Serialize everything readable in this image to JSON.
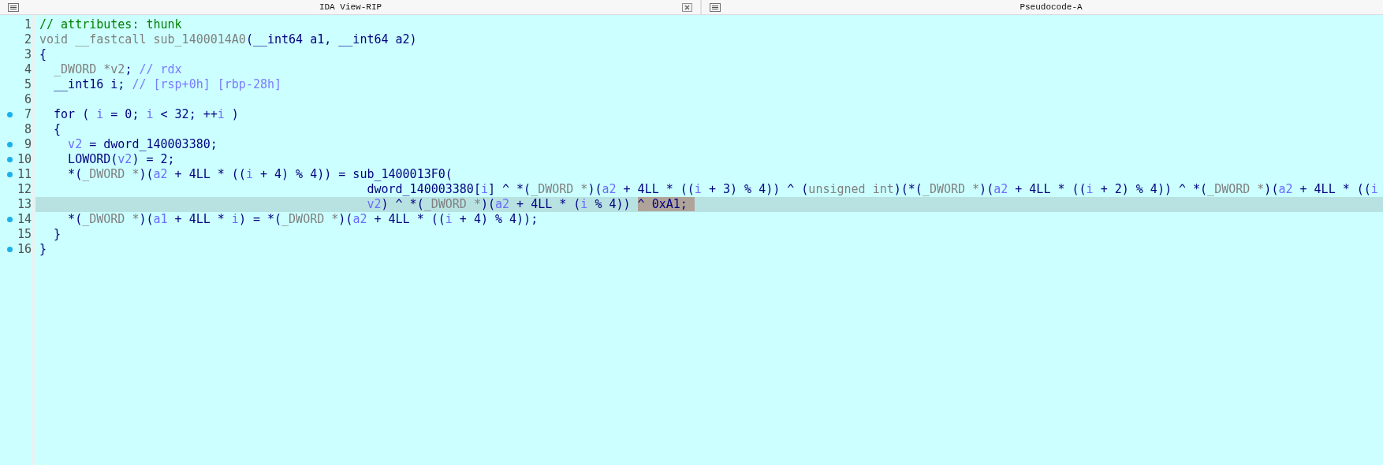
{
  "tabs": [
    {
      "title": "IDA View-RIP",
      "closable": true
    },
    {
      "title": "Pseudocode-A",
      "closable": false
    }
  ],
  "lines": [
    {
      "number": "1",
      "marked": false,
      "selected": false,
      "tokens": [
        {
          "kind": "attr",
          "text": "// attributes: thunk"
        }
      ]
    },
    {
      "number": "2",
      "marked": false,
      "selected": false,
      "tokens": [
        {
          "kind": "type",
          "text": "void __fastcall sub_1400014A0"
        },
        {
          "kind": "code",
          "text": "(__int64 a1, __int64 a2)"
        }
      ]
    },
    {
      "number": "3",
      "marked": false,
      "selected": false,
      "tokens": [
        {
          "kind": "code",
          "text": "{"
        }
      ]
    },
    {
      "number": "4",
      "marked": false,
      "selected": false,
      "tokens": [
        {
          "kind": "type",
          "text": "  _DWORD *v2"
        },
        {
          "kind": "code",
          "text": ";"
        },
        {
          "kind": "comment",
          "text": " // rdx"
        }
      ]
    },
    {
      "number": "5",
      "marked": false,
      "selected": false,
      "tokens": [
        {
          "kind": "code",
          "text": "  __int16 i;"
        },
        {
          "kind": "comment",
          "text": " // [rsp+0h] [rbp-28h]"
        }
      ]
    },
    {
      "number": "6",
      "marked": false,
      "selected": false
    },
    {
      "number": "7",
      "marked": true,
      "selected": false,
      "tokens": [
        {
          "kind": "code",
          "text": "  for ( "
        },
        {
          "kind": "var",
          "text": "i"
        },
        {
          "kind": "code",
          "text": " = 0; "
        },
        {
          "kind": "var",
          "text": "i"
        },
        {
          "kind": "code",
          "text": " < 32; ++"
        },
        {
          "kind": "var",
          "text": "i"
        },
        {
          "kind": "code",
          "text": " )"
        }
      ]
    },
    {
      "number": "8",
      "marked": false,
      "selected": false,
      "tokens": [
        {
          "kind": "code",
          "text": "  {"
        }
      ]
    },
    {
      "number": "9",
      "marked": true,
      "selected": false,
      "tokens": [
        {
          "kind": "var",
          "text": "    v2"
        },
        {
          "kind": "code",
          "text": " = dword_140003380;"
        }
      ]
    },
    {
      "number": "10",
      "marked": true,
      "selected": false,
      "tokens": [
        {
          "kind": "code",
          "text": "    LOWORD("
        },
        {
          "kind": "var",
          "text": "v2"
        },
        {
          "kind": "code",
          "text": ") = 2;"
        }
      ]
    },
    {
      "number": "11",
      "marked": true,
      "selected": false,
      "tokens": [
        {
          "kind": "code",
          "text": "    *("
        },
        {
          "kind": "type",
          "text": "_DWORD *"
        },
        {
          "kind": "code",
          "text": ")("
        },
        {
          "kind": "var",
          "text": "a2"
        },
        {
          "kind": "code",
          "text": " + 4LL * (("
        },
        {
          "kind": "var",
          "text": "i"
        },
        {
          "kind": "code",
          "text": " + 4) % 4)) = sub_1400013F0("
        }
      ]
    },
    {
      "number": "12",
      "marked": false,
      "selected": false,
      "tokens": [
        {
          "kind": "code",
          "text": "                                              dword_140003380["
        },
        {
          "kind": "var",
          "text": "i"
        },
        {
          "kind": "code",
          "text": "] ^ *("
        },
        {
          "kind": "type",
          "text": "_DWORD *"
        },
        {
          "kind": "code",
          "text": ")("
        },
        {
          "kind": "var",
          "text": "a2"
        },
        {
          "kind": "code",
          "text": " + 4LL * (("
        },
        {
          "kind": "var",
          "text": "i"
        },
        {
          "kind": "code",
          "text": " + 3) % 4)) ^ ("
        },
        {
          "kind": "type",
          "text": "unsigned int"
        },
        {
          "kind": "code",
          "text": ")(*("
        },
        {
          "kind": "type",
          "text": "_DWORD *"
        },
        {
          "kind": "code",
          "text": ")("
        },
        {
          "kind": "var",
          "text": "a2"
        },
        {
          "kind": "code",
          "text": " + 4LL * (("
        },
        {
          "kind": "var",
          "text": "i"
        },
        {
          "kind": "code",
          "text": " + 2) % 4)) ^ *("
        },
        {
          "kind": "type",
          "text": "_DWORD *"
        },
        {
          "kind": "code",
          "text": ")("
        },
        {
          "kind": "var",
          "text": "a2"
        },
        {
          "kind": "code",
          "text": " + 4LL * (("
        },
        {
          "kind": "var",
          "text": "i"
        }
      ]
    },
    {
      "number": "13",
      "marked": false,
      "selected": true,
      "tokens": [
        {
          "kind": "var",
          "text": "                                              v2"
        },
        {
          "kind": "code",
          "text": ") ^ *("
        },
        {
          "kind": "type",
          "text": "_DWORD *"
        },
        {
          "kind": "code",
          "text": ")("
        },
        {
          "kind": "var",
          "text": "a2"
        },
        {
          "kind": "code",
          "text": " + 4LL * ("
        },
        {
          "kind": "var",
          "text": "i"
        },
        {
          "kind": "code",
          "text": " % 4)) "
        },
        {
          "kind": "code",
          "text": "^ 0xA1;",
          "highlighted": true
        }
      ]
    },
    {
      "number": "14",
      "marked": true,
      "selected": false,
      "tokens": [
        {
          "kind": "code",
          "text": "    *("
        },
        {
          "kind": "type",
          "text": "_DWORD *"
        },
        {
          "kind": "code",
          "text": ")("
        },
        {
          "kind": "var",
          "text": "a1"
        },
        {
          "kind": "code",
          "text": " + 4LL * "
        },
        {
          "kind": "var",
          "text": "i"
        },
        {
          "kind": "code",
          "text": ") = *("
        },
        {
          "kind": "type",
          "text": "_DWORD *"
        },
        {
          "kind": "code",
          "text": ")("
        },
        {
          "kind": "var",
          "text": "a2"
        },
        {
          "kind": "code",
          "text": " + 4LL * (("
        },
        {
          "kind": "var",
          "text": "i"
        },
        {
          "kind": "code",
          "text": " + 4) % 4));"
        }
      ]
    },
    {
      "number": "15",
      "marked": false,
      "selected": false,
      "tokens": [
        {
          "kind": "code",
          "text": "  }"
        }
      ]
    },
    {
      "number": "16",
      "marked": true,
      "selected": false,
      "tokens": [
        {
          "kind": "code",
          "text": "}"
        }
      ]
    }
  ]
}
